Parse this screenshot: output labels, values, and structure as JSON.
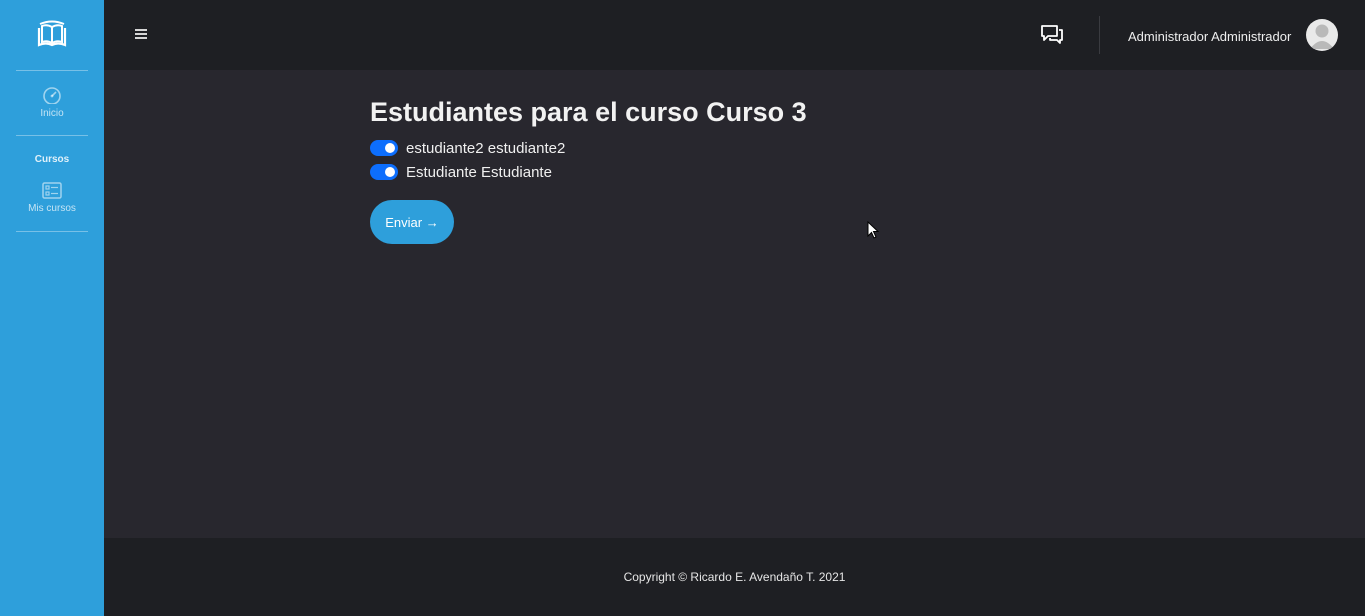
{
  "sidebar": {
    "logo_icon": "book-icon",
    "items": [
      {
        "label": "Inicio",
        "icon": "dashboard-icon"
      }
    ],
    "section_title": "Cursos",
    "section_items": [
      {
        "label": "Mis cursos",
        "icon": "courses-list-icon"
      }
    ],
    "background": "#2e9fdb"
  },
  "topbar": {
    "menu_icon": "hamburger-icon",
    "chat_icon": "chat-icon",
    "user_name": "Administrador Administrador",
    "avatar_icon": "user-avatar-icon"
  },
  "main": {
    "title": "Estudiantes para el curso Curso 3",
    "students": [
      {
        "name": "estudiante2 estudiante2",
        "enabled": true
      },
      {
        "name": "Estudiante Estudiante",
        "enabled": true
      }
    ],
    "submit_label": "Enviar →"
  },
  "footer": {
    "copyright": "Copyright © Ricardo E. Avendaño T. 2021"
  },
  "colors": {
    "accent": "#2e9fdb",
    "toggle_on": "#0d6efd",
    "background": "#28272e",
    "bars": "#1e1f23"
  }
}
